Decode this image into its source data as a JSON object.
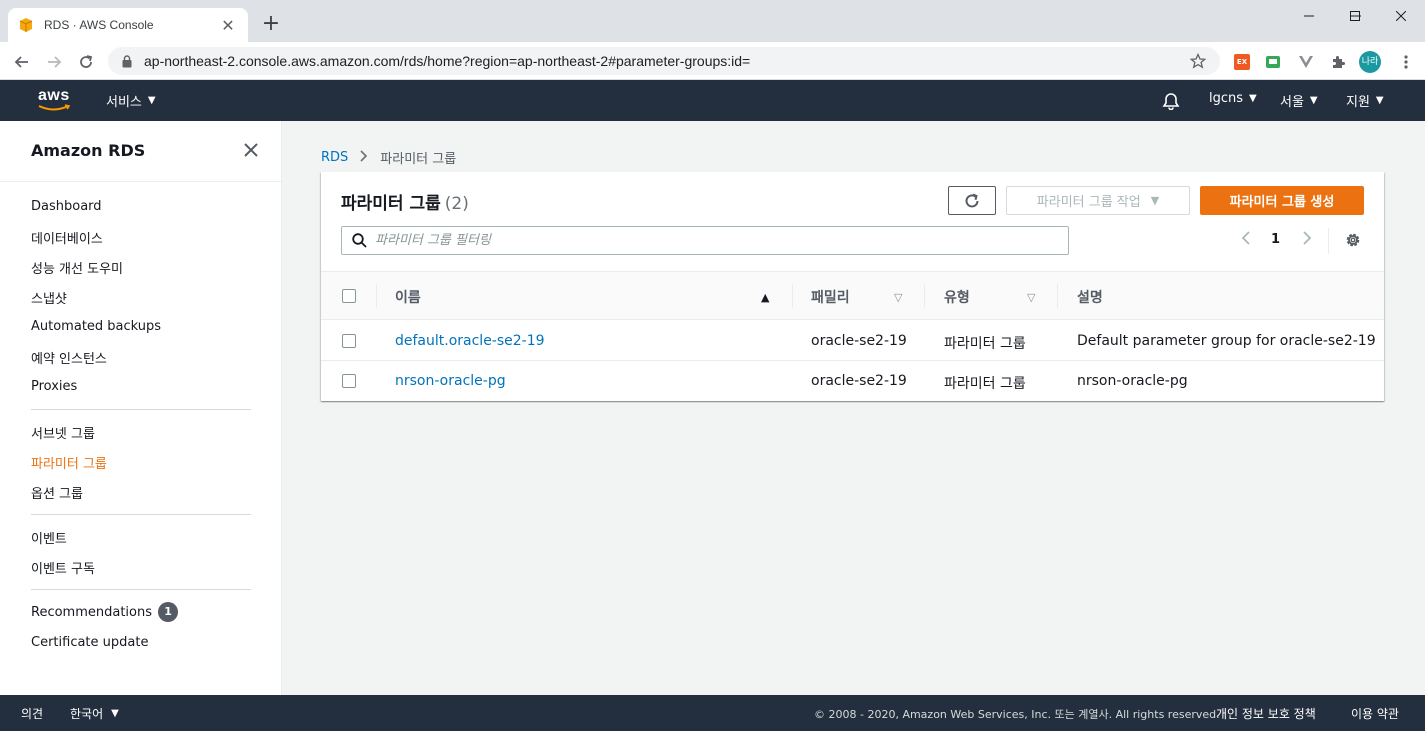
{
  "browser": {
    "tab_title": "RDS · AWS Console",
    "url": "ap-northeast-2.console.aws.amazon.com/rds/home?region=ap-northeast-2#parameter-groups:id=",
    "profile_label": "나라",
    "ext_label": "EX"
  },
  "aws_nav": {
    "logo": "aws",
    "services": "서비스",
    "account": "lgcns",
    "region": "서울",
    "support": "지원"
  },
  "sidebar": {
    "title": "Amazon RDS",
    "items": [
      {
        "label": "Dashboard"
      },
      {
        "label": "데이터베이스"
      },
      {
        "label": "성능 개선 도우미"
      },
      {
        "label": "스냅샷"
      },
      {
        "label": "Automated backups"
      },
      {
        "label": "예약 인스턴스"
      },
      {
        "label": "Proxies"
      },
      {
        "label": "서브넷 그룹"
      },
      {
        "label": "파라미터 그룹"
      },
      {
        "label": "옵션 그룹"
      },
      {
        "label": "이벤트"
      },
      {
        "label": "이벤트 구독"
      },
      {
        "label": "Recommendations"
      },
      {
        "label": "Certificate update"
      }
    ],
    "recommendations_badge": "1"
  },
  "breadcrumb": {
    "root": "RDS",
    "current": "파라미터 그룹"
  },
  "panel": {
    "title": "파라미터 그룹",
    "count": "(2)",
    "actions_label": "파라미터 그룹 작업",
    "create_label": "파라미터 그룹 생성",
    "search_placeholder": "파라미터 그룹 필터링",
    "page": "1"
  },
  "table": {
    "columns": [
      "이름",
      "패밀리",
      "유형",
      "설명"
    ],
    "rows": [
      {
        "name": "default.oracle-se2-19",
        "family": "oracle-se2-19",
        "type": "파라미터 그룹",
        "description": "Default parameter group for oracle-se2-19"
      },
      {
        "name": "nrson-oracle-pg",
        "family": "oracle-se2-19",
        "type": "파라미터 그룹",
        "description": "nrson-oracle-pg"
      }
    ]
  },
  "footer": {
    "feedback": "의견",
    "language": "한국어",
    "copyright": "© 2008 - 2020, Amazon Web Services, Inc. 또는 계열사. All rights reserved.",
    "privacy": "개인 정보 보호 정책",
    "terms": "이용 약관"
  },
  "colors": {
    "aws_nav_bg": "#232f3e",
    "accent_orange": "#ec7211",
    "link_blue": "#0073bb"
  }
}
